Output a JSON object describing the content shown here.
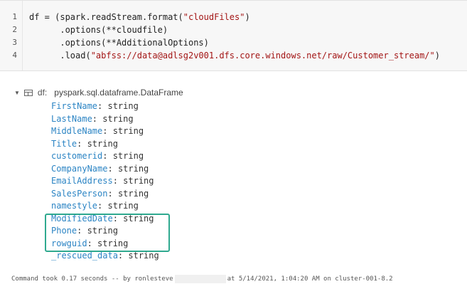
{
  "code": {
    "lines": [
      {
        "num": "1",
        "pre": "df = (spark.readStream.format(",
        "str": "\"cloudFiles\"",
        "post": ")"
      },
      {
        "num": "2",
        "pre": "      .options(**cloudfile)",
        "str": "",
        "post": ""
      },
      {
        "num": "3",
        "pre": "      .options(**AdditionalOptions)",
        "str": "",
        "post": ""
      },
      {
        "num": "4",
        "pre": "      .load(",
        "str": "\"abfss://data@adlsg2v001.dfs.core.windows.net/raw/Customer_stream/\"",
        "post": ")"
      }
    ]
  },
  "schema": {
    "name": "df:",
    "type": "pyspark.sql.dataframe.DataFrame",
    "fields": [
      {
        "name": "FirstName",
        "type": "string"
      },
      {
        "name": "LastName",
        "type": "string"
      },
      {
        "name": "MiddleName",
        "type": "string"
      },
      {
        "name": "Title",
        "type": "string"
      },
      {
        "name": "customerid",
        "type": "string"
      },
      {
        "name": "CompanyName",
        "type": "string"
      },
      {
        "name": "EmailAddress",
        "type": "string"
      },
      {
        "name": "SalesPerson",
        "type": "string"
      },
      {
        "name": "namestyle",
        "type": "string"
      },
      {
        "name": "ModifiedDate",
        "type": "string"
      },
      {
        "name": "Phone",
        "type": "string"
      },
      {
        "name": "rowguid",
        "type": "string"
      },
      {
        "name": "_rescued_data",
        "type": "string"
      }
    ]
  },
  "footer": {
    "before": "Command took 0.17 seconds -- by ronlesteve",
    "after": "at 5/14/2021, 1:04:20 AM on cluster-001-8.2"
  },
  "colors": {
    "field_name": "#2b84c4",
    "highlight_border": "#2fa98f",
    "string_literal": "#a31515"
  }
}
